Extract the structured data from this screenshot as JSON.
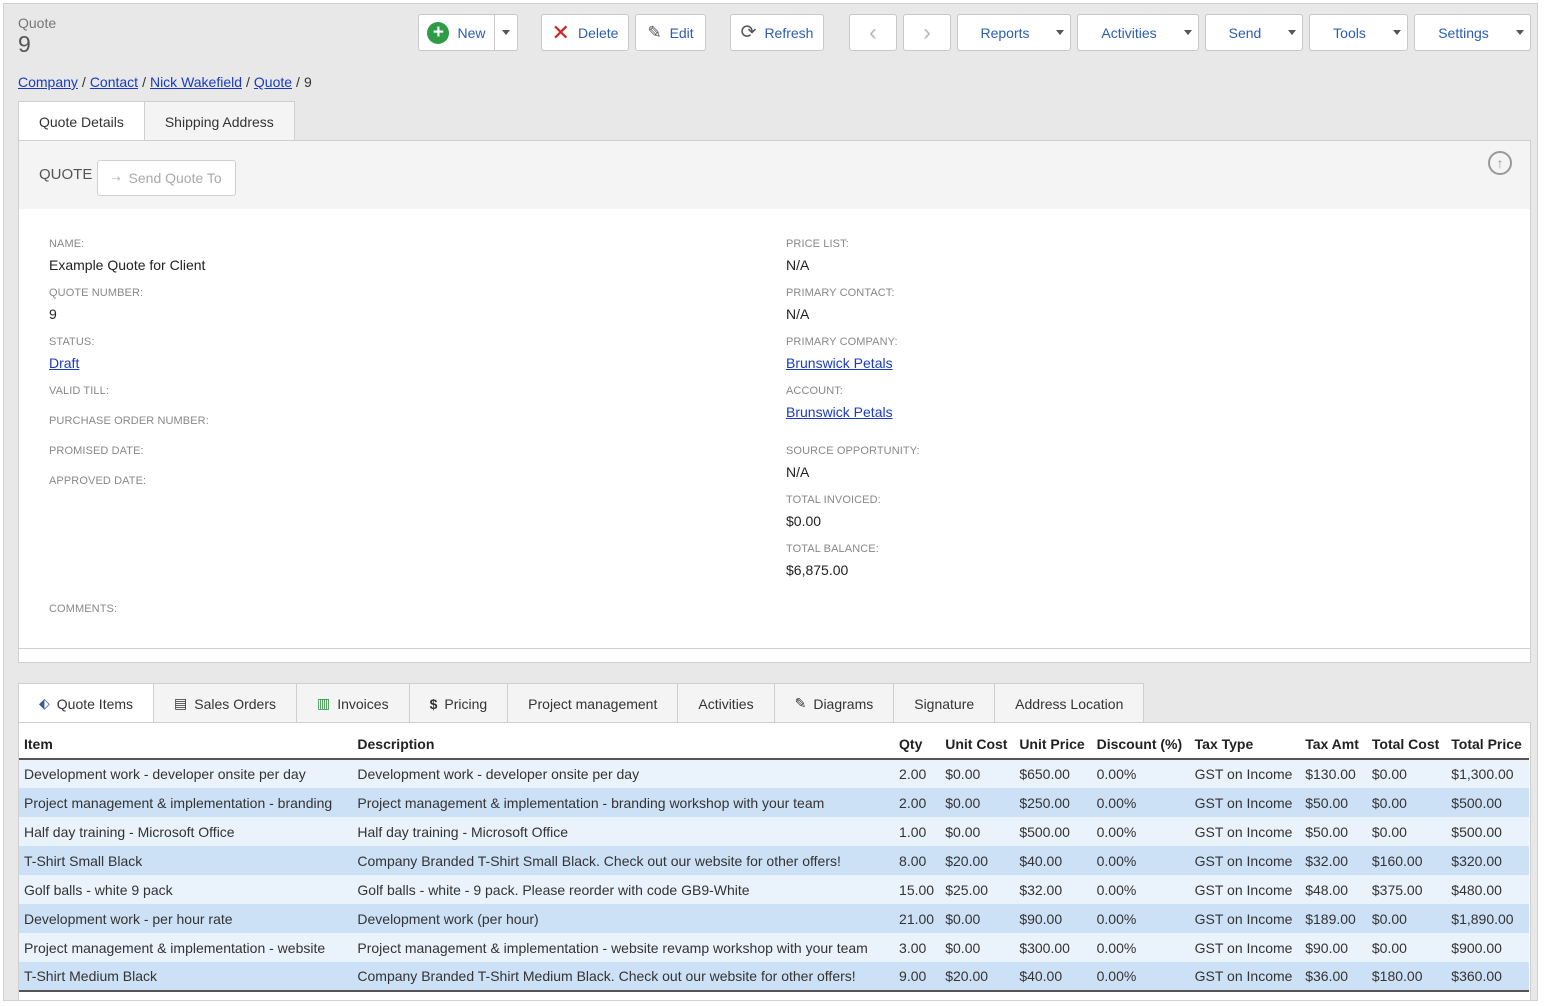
{
  "record": {
    "type": "Quote",
    "id": "9"
  },
  "toolbar": {
    "new": "New",
    "delete": "Delete",
    "edit": "Edit",
    "refresh": "Refresh",
    "reports": "Reports",
    "activities": "Activities",
    "send": "Send",
    "tools": "Tools",
    "settings": "Settings"
  },
  "breadcrumb": {
    "items": [
      "Company",
      "Contact",
      "Nick Wakefield",
      "Quote"
    ],
    "current": "9"
  },
  "tabs": {
    "details": "Quote Details",
    "shipping": "Shipping Address"
  },
  "panel": {
    "title": "QUOTE",
    "send_quote": "Send Quote To"
  },
  "fields_left": [
    {
      "label": "NAME:",
      "value": "Example Quote for Client"
    },
    {
      "label": "QUOTE NUMBER:",
      "value": "9"
    },
    {
      "label": "STATUS:",
      "value": "Draft",
      "link": true
    },
    {
      "label": "VALID TILL:",
      "value": ""
    },
    {
      "label": "PURCHASE ORDER NUMBER:",
      "value": ""
    },
    {
      "label": "PROMISED DATE:",
      "value": ""
    },
    {
      "label": "APPROVED DATE:",
      "value": ""
    },
    {
      "label": "COMMENTS:",
      "value": ""
    }
  ],
  "fields_right": [
    {
      "label": "PRICE LIST:",
      "value": "N/A"
    },
    {
      "label": "PRIMARY CONTACT:",
      "value": "N/A"
    },
    {
      "label": "PRIMARY COMPANY:",
      "value": "Brunswick Petals",
      "link": true
    },
    {
      "label": "ACCOUNT:",
      "value": "Brunswick Petals",
      "link": true
    },
    {
      "label": "SOURCE OPPORTUNITY:",
      "value": "N/A"
    },
    {
      "label": "TOTAL INVOICED:",
      "value": "$0.00"
    },
    {
      "label": "TOTAL BALANCE:",
      "value": "$6,875.00"
    }
  ],
  "sub_tabs": [
    {
      "label": "Quote Items",
      "icon": "tag-icon"
    },
    {
      "label": "Sales Orders",
      "icon": "document-icon"
    },
    {
      "label": "Invoices",
      "icon": "invoice-icon"
    },
    {
      "label": "Pricing",
      "icon": "dollar-icon"
    },
    {
      "label": "Project management",
      "icon": ""
    },
    {
      "label": "Activities",
      "icon": ""
    },
    {
      "label": "Diagrams",
      "icon": "pencil-icon"
    },
    {
      "label": "Signature",
      "icon": ""
    },
    {
      "label": "Address Location",
      "icon": ""
    }
  ],
  "items_table": {
    "columns": [
      "Item",
      "Description",
      "Qty",
      "Unit Cost",
      "Unit Price",
      "Discount (%)",
      "Tax Type",
      "Tax Amt",
      "Total Cost",
      "Total Price"
    ],
    "rows": [
      [
        "Development work - developer onsite per day",
        "Development work - developer onsite per day",
        "2.00",
        "$0.00",
        "$650.00",
        "0.00%",
        "GST on Income",
        "$130.00",
        "$0.00",
        "$1,300.00"
      ],
      [
        "Project management & implementation - branding",
        "Project management & implementation - branding workshop with your team",
        "2.00",
        "$0.00",
        "$250.00",
        "0.00%",
        "GST on Income",
        "$50.00",
        "$0.00",
        "$500.00"
      ],
      [
        "Half day training - Microsoft Office",
        "Half day training - Microsoft Office",
        "1.00",
        "$0.00",
        "$500.00",
        "0.00%",
        "GST on Income",
        "$50.00",
        "$0.00",
        "$500.00"
      ],
      [
        "T-Shirt Small Black",
        "Company Branded T-Shirt Small Black. Check out our website for other offers!",
        "8.00",
        "$20.00",
        "$40.00",
        "0.00%",
        "GST on Income",
        "$32.00",
        "$160.00",
        "$320.00"
      ],
      [
        "Golf balls - white 9 pack",
        "Golf balls - white - 9 pack. Please reorder with code GB9-White",
        "15.00",
        "$25.00",
        "$32.00",
        "0.00%",
        "GST on Income",
        "$48.00",
        "$375.00",
        "$480.00"
      ],
      [
        "Development work - per hour rate",
        "Development work (per hour)",
        "21.00",
        "$0.00",
        "$90.00",
        "0.00%",
        "GST on Income",
        "$189.00",
        "$0.00",
        "$1,890.00"
      ],
      [
        "Project management & implementation - website",
        "Project management & implementation - website revamp workshop with your team",
        "3.00",
        "$0.00",
        "$300.00",
        "0.00%",
        "GST on Income",
        "$90.00",
        "$0.00",
        "$900.00"
      ],
      [
        "T-Shirt Medium Black",
        "Company Branded T-Shirt Medium Black. Check out our website for other offers!",
        "9.00",
        "$20.00",
        "$40.00",
        "0.00%",
        "GST on Income",
        "$36.00",
        "$180.00",
        "$360.00"
      ]
    ]
  }
}
